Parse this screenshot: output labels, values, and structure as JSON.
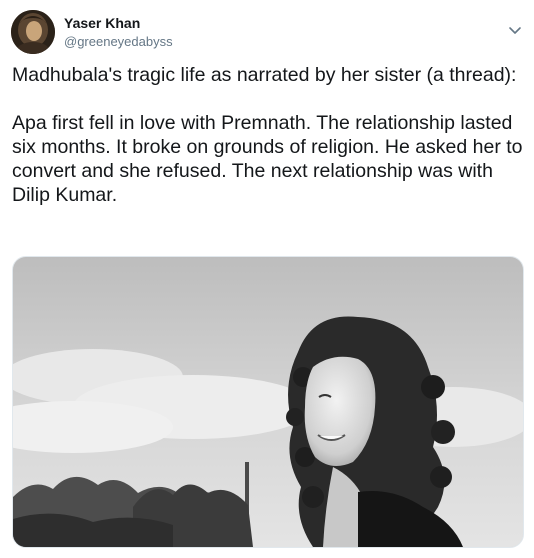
{
  "tweet": {
    "author": {
      "name": "Yaser Khan",
      "handle": "@greeneyedabyss"
    },
    "text": "Madhubala's tragic life as narrated by her sister (a thread):\n\nApa first fell in love with Premnath. The relationship lasted six months. It broke on grounds of religion. He asked her to convert and she refused. The next relationship was with Dilip Kumar.",
    "icons": {
      "more": "chevron-down-icon",
      "avatar": "avatar"
    },
    "media": {
      "type": "black-and-white photograph"
    }
  }
}
